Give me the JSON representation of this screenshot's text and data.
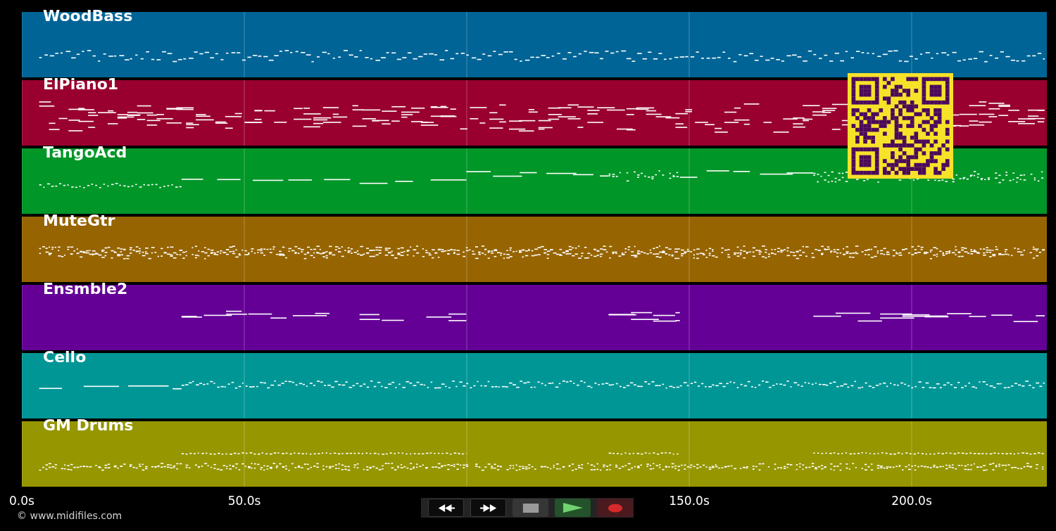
{
  "tracks": [
    {
      "name": "WoodBass",
      "color": "#006496"
    },
    {
      "name": "ElPiano1",
      "color": "#990030"
    },
    {
      "name": "TangoAcd",
      "color": "#009628"
    },
    {
      "name": "MuteGtr",
      "color": "#966400"
    },
    {
      "name": "Ensmble2",
      "color": "#640096"
    },
    {
      "name": "Cello",
      "color": "#009696"
    },
    {
      "name": "GM Drums",
      "color": "#969600"
    }
  ],
  "axis": {
    "ticks": [
      "0.0s",
      "50.0s",
      "150.0s",
      "200.0s"
    ]
  },
  "transport": {
    "buttons": [
      {
        "kind": "rewind"
      },
      {
        "kind": "fast_forward"
      },
      {
        "kind": "stop"
      },
      {
        "kind": "play"
      },
      {
        "kind": "record"
      }
    ]
  },
  "copyright": "© www.midifiles.com"
}
